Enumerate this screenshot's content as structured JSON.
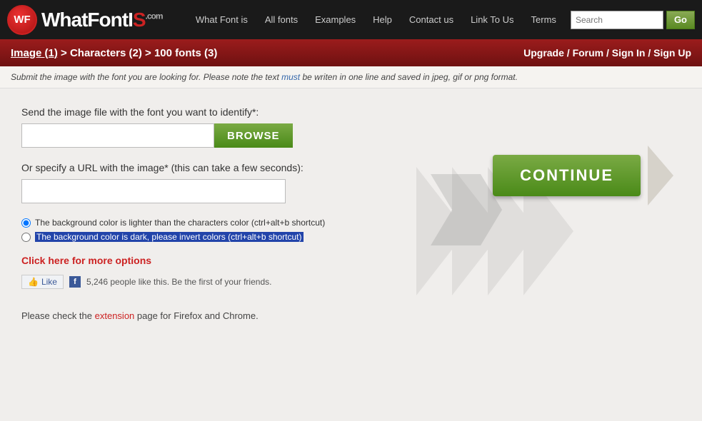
{
  "header": {
    "logo_badge": "WF",
    "logo_name": "WhatFontI",
    "logo_s": "S",
    "logo_dotcom": ".com",
    "nav": {
      "items": [
        {
          "label": "What Font is",
          "id": "what-font-is"
        },
        {
          "label": "All fonts",
          "id": "all-fonts"
        },
        {
          "label": "Examples",
          "id": "examples"
        },
        {
          "label": "Help",
          "id": "help"
        },
        {
          "label": "Contact us",
          "id": "contact-us"
        },
        {
          "label": "Link To Us",
          "id": "link-to-us"
        },
        {
          "label": "Terms",
          "id": "terms"
        }
      ]
    },
    "search": {
      "placeholder": "Search",
      "button_label": "Go"
    }
  },
  "breadcrumb": {
    "step1": "Image (1)",
    "separator1": " > ",
    "step2": "Characters (2)",
    "separator2": " > ",
    "step3": "100 fonts (3)"
  },
  "user_actions": "Upgrade / Forum / Sign In / Sign Up",
  "info_bar": {
    "text_before": "Submit the image with the font you are looking for. Please note the text ",
    "must_text": "must",
    "text_after": " be writen in one line and saved in jpeg, gif or png format."
  },
  "form": {
    "file_label": "Send the image file with the font you want to identify*:",
    "file_placeholder": "",
    "browse_label": "BROWSE",
    "url_label": "Or specify a URL with the image* (this can take a few seconds):",
    "url_placeholder": "",
    "radio1_text": "The background color is lighter than the characters color (ctrl+alt+b shortcut)",
    "radio2_text": "The background color is dark, please invert colors (ctrl+alt+b shortcut)",
    "more_options": "Click here for more options",
    "continue_label": "CONTINUE"
  },
  "facebook": {
    "like_label": "Like",
    "count_text": "5,246 people like this. Be the first of your friends."
  },
  "footer": {
    "text_before": "Please check the ",
    "extension_link": "extension",
    "text_after": " page for Firefox and Chrome."
  }
}
